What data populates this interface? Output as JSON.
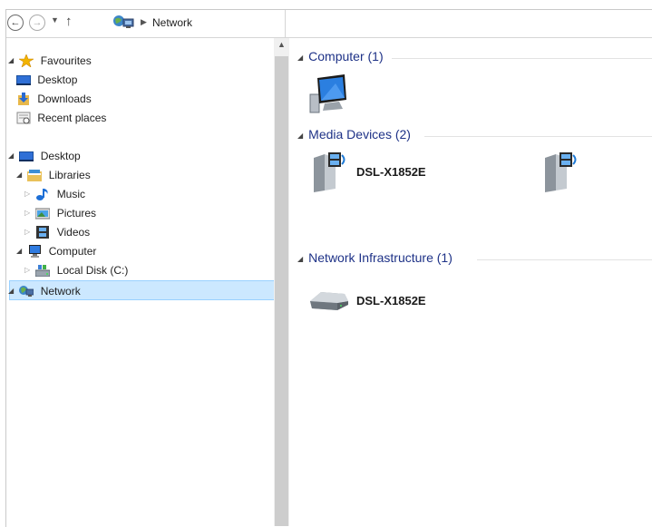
{
  "address_bar": {
    "back_icon": "back-arrow-icon",
    "forward_icon": "forward-arrow-icon",
    "up_icon": "up-arrow-icon",
    "path": "Network"
  },
  "nav_tree": [
    {
      "label": "Favourites",
      "icon": "star-icon",
      "expander": "expanded"
    },
    {
      "label": "Desktop",
      "icon": "desktop-icon"
    },
    {
      "label": "Downloads",
      "icon": "downloads-icon"
    },
    {
      "label": "Recent places",
      "icon": "recent-places-icon"
    },
    {
      "label": "Desktop",
      "icon": "desktop-icon",
      "expander": "expanded"
    },
    {
      "label": "Libraries",
      "icon": "libraries-icon",
      "expander": "expanded"
    },
    {
      "label": "Music",
      "icon": "music-icon",
      "expander": "collapsed"
    },
    {
      "label": "Pictures",
      "icon": "pictures-icon",
      "expander": "collapsed"
    },
    {
      "label": "Videos",
      "icon": "videos-icon",
      "expander": "collapsed"
    },
    {
      "label": "Computer",
      "icon": "computer-icon",
      "expander": "expanded"
    },
    {
      "label": "Local Disk (C:)",
      "icon": "local-disk-icon",
      "expander": "collapsed"
    },
    {
      "label": "Network",
      "icon": "network-icon",
      "expander": "expanded",
      "selected": true
    }
  ],
  "groups": [
    {
      "title": "Computer (1)",
      "items": [
        {
          "label": "",
          "icon": "computer-monitor-icon"
        }
      ]
    },
    {
      "title": "Media Devices (2)",
      "items": [
        {
          "label": "DSL-X1852E",
          "icon": "media-device-icon"
        },
        {
          "label": "",
          "icon": "media-device-icon"
        }
      ]
    },
    {
      "title": "Network Infrastructure (1)",
      "items": [
        {
          "label": "DSL-X1852E",
          "icon": "router-icon"
        }
      ]
    }
  ],
  "colors": {
    "selection_bg": "#cce8ff",
    "selection_border": "#99d1ff",
    "group_header": "#1e3287"
  }
}
